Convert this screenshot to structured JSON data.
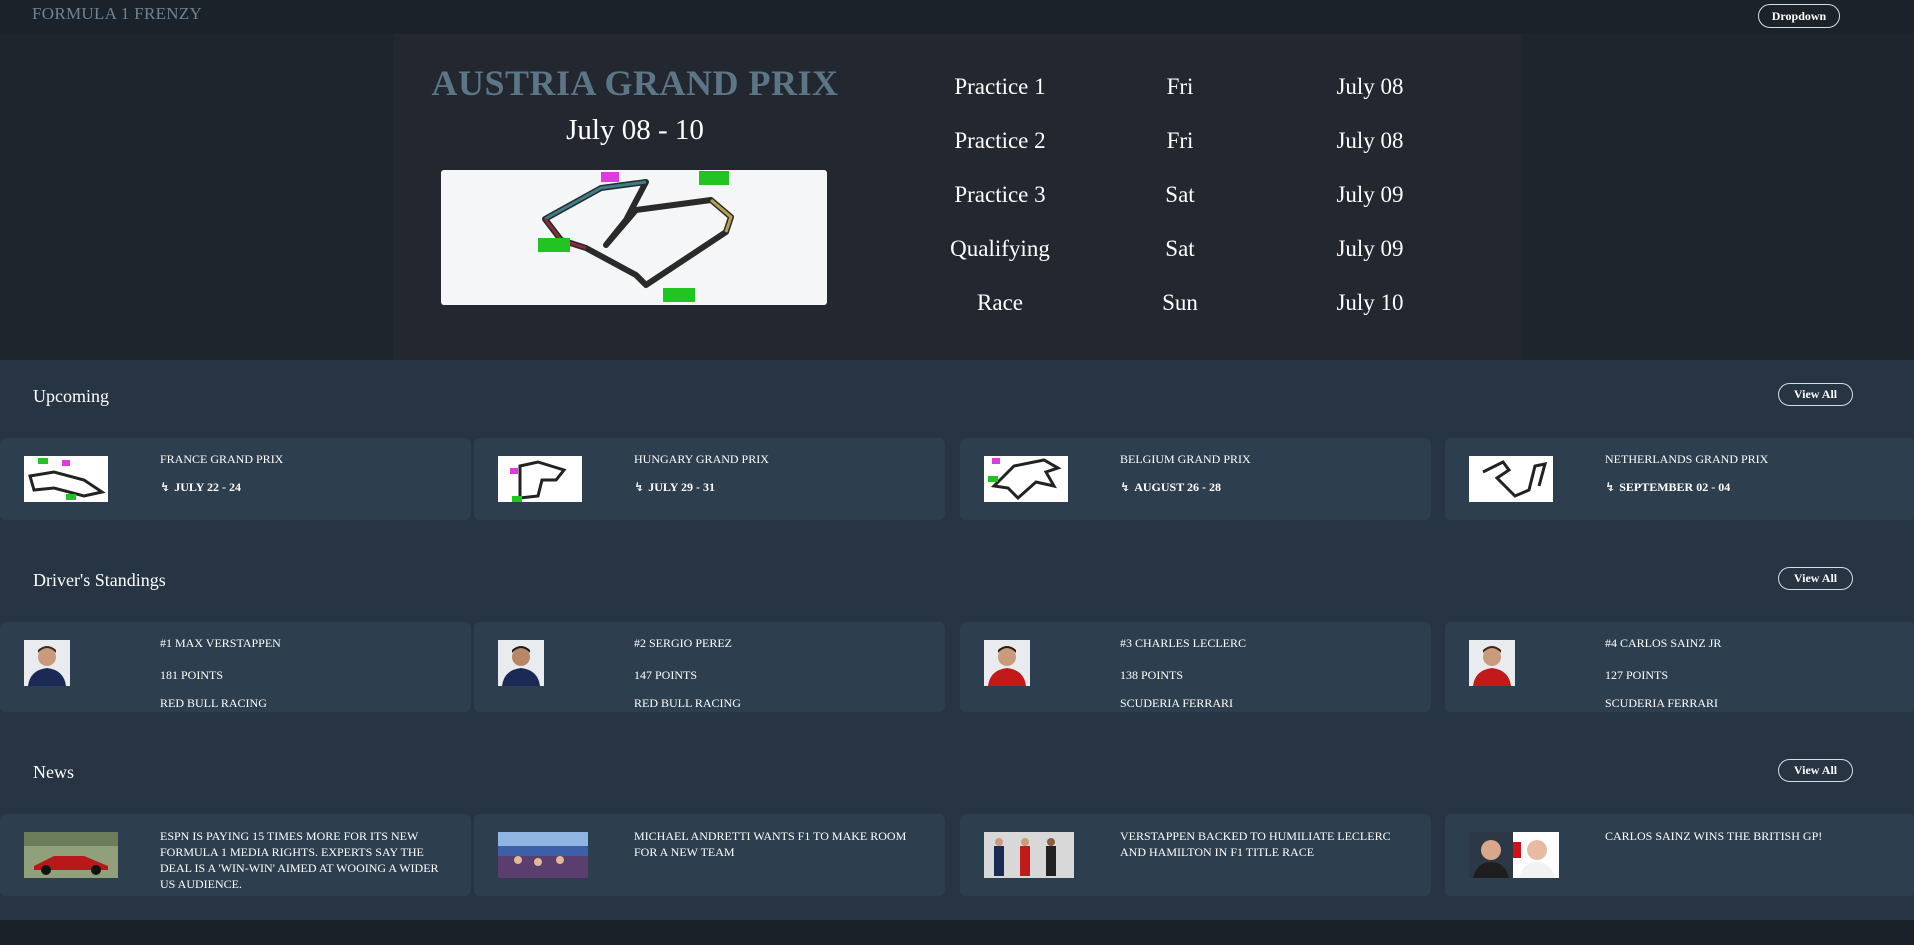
{
  "header": {
    "brand": "FORMULA 1 FRENZY",
    "dropdown_label": "Dropdown"
  },
  "hero": {
    "title": "AUSTRIA GRAND PRIX",
    "dates": "July 08 - 10",
    "sessions": [
      {
        "name": "Practice 1",
        "day": "Fri",
        "date": "July 08"
      },
      {
        "name": "Practice 2",
        "day": "Fri",
        "date": "July 08"
      },
      {
        "name": "Practice 3",
        "day": "Sat",
        "date": "July 09"
      },
      {
        "name": "Qualifying",
        "day": "Sat",
        "date": "July 09"
      },
      {
        "name": "Race",
        "day": "Sun",
        "date": "July 10"
      }
    ]
  },
  "upcoming": {
    "title": "Upcoming",
    "view_all": "View All",
    "items": [
      {
        "name": "FRANCE GRAND PRIX",
        "dates": "JULY 22 - 24",
        "icon": "lightning-icon"
      },
      {
        "name": "HUNGARY GRAND PRIX",
        "dates": "JULY 29 - 31",
        "icon": "lightning-icon"
      },
      {
        "name": "BELGIUM GRAND PRIX",
        "dates": "AUGUST 26 - 28",
        "icon": "lightning-icon"
      },
      {
        "name": "NETHERLANDS GRAND PRIX",
        "dates": "SEPTEMBER 02 - 04",
        "icon": "lightning-icon"
      }
    ]
  },
  "standings": {
    "title": "Driver's Standings",
    "view_all": "View All",
    "items": [
      {
        "rank_name": "#1 MAX VERSTAPPEN",
        "points": "181 POINTS",
        "team": "RED BULL RACING"
      },
      {
        "rank_name": "#2 SERGIO PEREZ",
        "points": "147 POINTS",
        "team": "RED BULL RACING"
      },
      {
        "rank_name": "#3 CHARLES LECLERC",
        "points": "138 POINTS",
        "team": "SCUDERIA FERRARI"
      },
      {
        "rank_name": "#4 CARLOS SAINZ JR",
        "points": "127 POINTS",
        "team": "SCUDERIA FERRARI"
      }
    ]
  },
  "news": {
    "title": "News",
    "view_all": "View All",
    "items": [
      {
        "headline": "ESPN IS PAYING 15 TIMES MORE FOR ITS NEW FORMULA 1 MEDIA RIGHTS. EXPERTS SAY THE DEAL IS A 'WIN-WIN' AIMED AT WOOING A WIDER US AUDIENCE."
      },
      {
        "headline": "MICHAEL ANDRETTI WANTS F1 TO MAKE ROOM FOR A NEW TEAM"
      },
      {
        "headline": "VERSTAPPEN BACKED TO HUMILIATE LECLERC AND HAMILTON IN F1 TITLE RACE"
      },
      {
        "headline": "CARLOS SAINZ WINS THE BRITISH GP!"
      }
    ]
  },
  "colors": {
    "page_bg": "#1b222a",
    "hero_bg": "#232830",
    "section_bg": "#263443",
    "card_bg": "#2d3e4f",
    "accent_title": "#5d7687"
  }
}
